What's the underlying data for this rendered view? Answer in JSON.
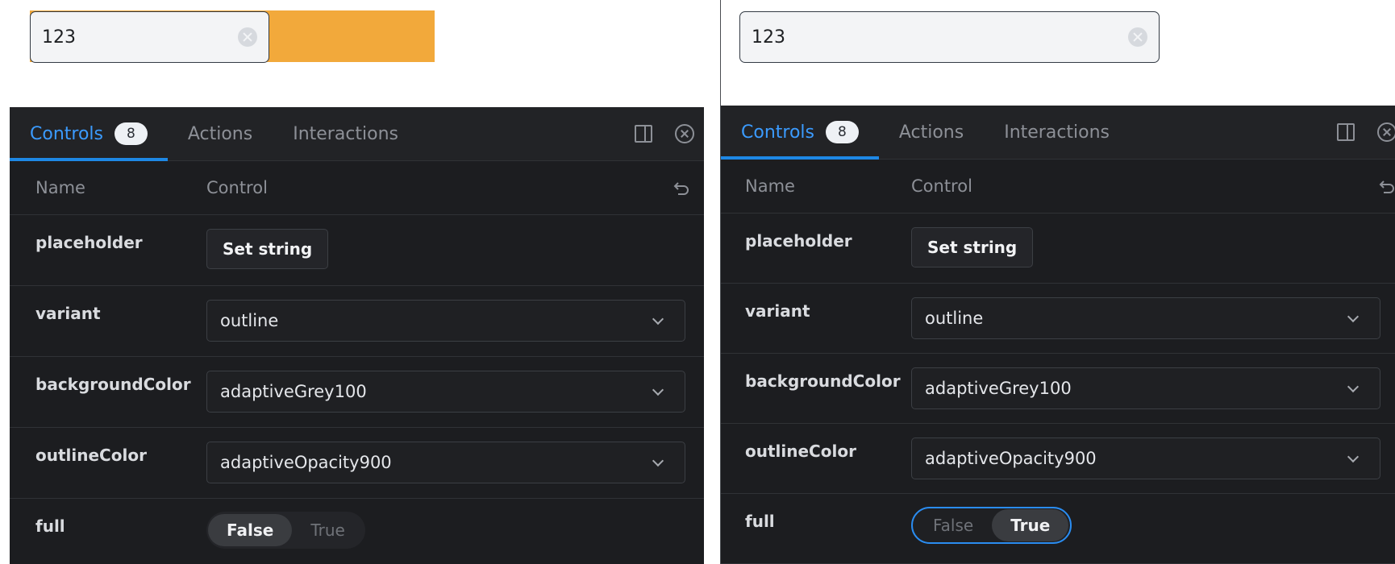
{
  "preview_left": {
    "input_value": "123"
  },
  "preview_right": {
    "input_value": "123"
  },
  "panel": {
    "tabs": [
      {
        "label": "Controls",
        "badge": "8"
      },
      {
        "label": "Actions"
      },
      {
        "label": "Interactions"
      }
    ],
    "columns": {
      "name": "Name",
      "control": "Control"
    },
    "rows": {
      "placeholder": {
        "name": "placeholder",
        "button": "Set string"
      },
      "variant": {
        "name": "variant",
        "value": "outline"
      },
      "backgroundColor": {
        "name": "backgroundColor",
        "value": "adaptiveGrey100"
      },
      "outlineColor": {
        "name": "outlineColor",
        "value": "adaptiveOpacity900"
      },
      "full": {
        "name": "full",
        "false_label": "False",
        "true_label": "True"
      }
    }
  },
  "state": {
    "left_full": "False",
    "right_full": "True"
  },
  "colors": {
    "accent": "#1e88e5",
    "preview_background": "#f2a93b",
    "panel_background": "#1c1d20"
  }
}
